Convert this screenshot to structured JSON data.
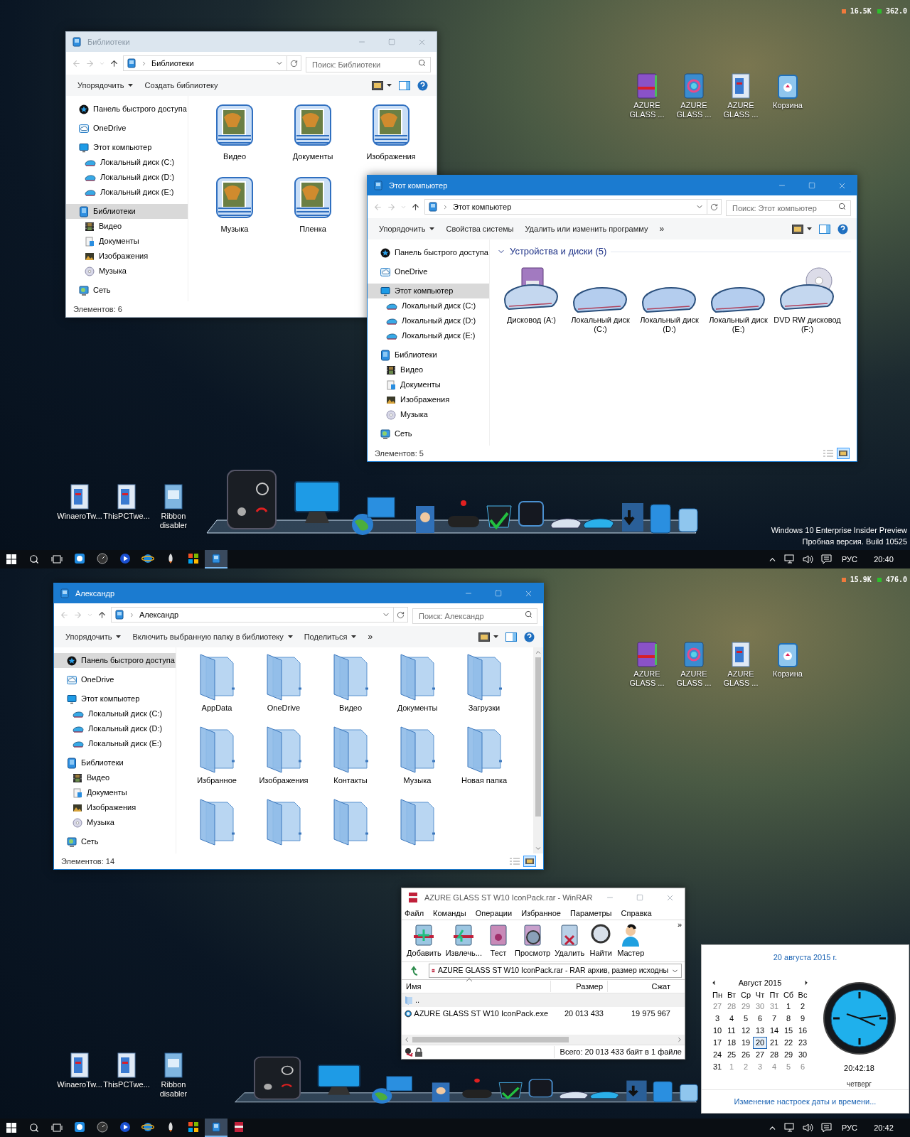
{
  "screens": [
    {
      "meter": [
        {
          "color": "#f07a3c",
          "text": "16.5K"
        },
        {
          "color": "#2cc02c",
          "text": "362.0"
        }
      ],
      "desktop_icons_right": [
        {
          "label": "AZURE GLASS ...",
          "kind": "package"
        },
        {
          "label": "AZURE GLASS ...",
          "kind": "installer"
        },
        {
          "label": "AZURE GLASS ...",
          "kind": "document"
        },
        {
          "label": "Корзина",
          "kind": "recycle"
        }
      ],
      "desktop_icons_left": [
        {
          "label": "WinaeroTw...",
          "kind": "document"
        },
        {
          "label": "ThisPCTwe...",
          "kind": "document"
        },
        {
          "label": "Ribbon disabler",
          "kind": "app"
        }
      ],
      "windows": [
        {
          "title": "Библиотеки",
          "active": false,
          "address": "Библиотеки",
          "search_placeholder": "Поиск: Библиотеки",
          "commands": [
            {
              "label": "Упорядочить",
              "dropdown": true
            },
            {
              "label": "Создать библиотеку",
              "dropdown": false
            }
          ],
          "nav": [
            {
              "label": "Панель быстрого доступа",
              "kind": "quick",
              "selected": false
            },
            {
              "label": "OneDrive",
              "kind": "onedrive",
              "selected": false
            },
            {
              "label": "Этот компьютер",
              "kind": "pc",
              "selected": false,
              "children": [
                {
                  "label": "Локальный диск (C:)",
                  "kind": "drive",
                  "selected": false
                },
                {
                  "label": "Локальный диск (D:)",
                  "kind": "drive",
                  "selected": false
                },
                {
                  "label": "Локальный диск (E:)",
                  "kind": "drive",
                  "selected": false
                }
              ]
            },
            {
              "label": "Библиотеки",
              "kind": "libraries",
              "selected": true,
              "children": [
                {
                  "label": "Видео",
                  "kind": "video",
                  "selected": false
                },
                {
                  "label": "Документы",
                  "kind": "documents",
                  "selected": false
                },
                {
                  "label": "Изображения",
                  "kind": "images",
                  "selected": false
                },
                {
                  "label": "Музыка",
                  "kind": "music",
                  "selected": false
                }
              ]
            },
            {
              "label": "Сеть",
              "kind": "network",
              "selected": false
            }
          ],
          "items": [
            {
              "label": "Видео",
              "kind": "library"
            },
            {
              "label": "Документы",
              "kind": "library"
            },
            {
              "label": "Изображения",
              "kind": "library"
            },
            {
              "label": "Музыка",
              "kind": "library"
            },
            {
              "label": "Пленка",
              "kind": "library"
            }
          ],
          "status": "Элементов: 6"
        },
        {
          "title": "Этот компьютер",
          "active": true,
          "address": "Этот компьютер",
          "search_placeholder": "Поиск: Этот компьютер",
          "commands": [
            {
              "label": "Упорядочить",
              "dropdown": true
            },
            {
              "label": "Свойства системы",
              "dropdown": false
            },
            {
              "label": "Удалить или изменить программу",
              "dropdown": false
            }
          ],
          "more": "»",
          "nav": [
            {
              "label": "Панель быстрого доступа",
              "kind": "quick",
              "selected": false
            },
            {
              "label": "OneDrive",
              "kind": "onedrive",
              "selected": false
            },
            {
              "label": "Этот компьютер",
              "kind": "pc",
              "selected": true,
              "children": [
                {
                  "label": "Локальный диск (C:)",
                  "kind": "drive",
                  "selected": false
                },
                {
                  "label": "Локальный диск (D:)",
                  "kind": "drive",
                  "selected": false
                },
                {
                  "label": "Локальный диск (E:)",
                  "kind": "drive",
                  "selected": false
                }
              ]
            },
            {
              "label": "Библиотеки",
              "kind": "libraries",
              "selected": false,
              "children": [
                {
                  "label": "Видео",
                  "kind": "video",
                  "selected": false
                },
                {
                  "label": "Документы",
                  "kind": "documents",
                  "selected": false
                },
                {
                  "label": "Изображения",
                  "kind": "images",
                  "selected": false
                },
                {
                  "label": "Музыка",
                  "kind": "music",
                  "selected": false
                }
              ]
            },
            {
              "label": "Сеть",
              "kind": "network",
              "selected": false
            }
          ],
          "group": "Устройства и диски (5)",
          "items": [
            {
              "label": "Дисковод (A:)",
              "kind": "floppy"
            },
            {
              "label": "Локальный диск (C:)",
              "kind": "drive"
            },
            {
              "label": "Локальный диск (D:)",
              "kind": "drive"
            },
            {
              "label": "Локальный диск (E:)",
              "kind": "drive"
            },
            {
              "label": "DVD RW дисковод (F:)",
              "kind": "dvd"
            }
          ],
          "status": "Элементов: 5",
          "view_toggle": true
        }
      ],
      "build_info": [
        "Windows 10 Enterprise Insider Preview",
        "Пробная версия. Build 10525"
      ],
      "taskbar": {
        "apps": [
          {
            "kind": "app",
            "selected": false
          },
          {
            "kind": "gauge",
            "selected": false
          },
          {
            "kind": "player",
            "selected": false
          },
          {
            "kind": "browser",
            "selected": false
          },
          {
            "kind": "rocket",
            "selected": false
          },
          {
            "kind": "tiles",
            "selected": false
          },
          {
            "kind": "explorer",
            "selected": true
          }
        ],
        "language": "РУС",
        "time": "20:40"
      }
    },
    {
      "meter": [
        {
          "color": "#f07a3c",
          "text": "15.9K"
        },
        {
          "color": "#2cc02c",
          "text": "476.0"
        }
      ],
      "desktop_icons_right": [
        {
          "label": "AZURE GLASS ...",
          "kind": "package"
        },
        {
          "label": "AZURE GLASS ...",
          "kind": "installer"
        },
        {
          "label": "AZURE GLASS ...",
          "kind": "document"
        },
        {
          "label": "Корзина",
          "kind": "recycle"
        }
      ],
      "desktop_icons_left": [
        {
          "label": "WinaeroTw...",
          "kind": "document"
        },
        {
          "label": "ThisPCTwe...",
          "kind": "document"
        },
        {
          "label": "Ribbon disabler",
          "kind": "app"
        }
      ],
      "windows": [
        {
          "title": "Александр",
          "active": true,
          "address": "Александр",
          "search_placeholder": "Поиск: Александр",
          "commands": [
            {
              "label": "Упорядочить",
              "dropdown": true
            },
            {
              "label": "Включить выбранную папку в библиотеку",
              "dropdown": true
            },
            {
              "label": "Поделиться",
              "dropdown": true
            }
          ],
          "more": "»",
          "nav": [
            {
              "label": "Панель быстрого доступа",
              "kind": "quick",
              "selected": true
            },
            {
              "label": "OneDrive",
              "kind": "onedrive",
              "selected": false
            },
            {
              "label": "Этот компьютер",
              "kind": "pc",
              "selected": false,
              "children": [
                {
                  "label": "Локальный диск (C:)",
                  "kind": "drive",
                  "selected": false
                },
                {
                  "label": "Локальный диск (D:)",
                  "kind": "drive",
                  "selected": false
                },
                {
                  "label": "Локальный диск (E:)",
                  "kind": "drive",
                  "selected": false
                }
              ]
            },
            {
              "label": "Библиотеки",
              "kind": "libraries",
              "selected": false,
              "children": [
                {
                  "label": "Видео",
                  "kind": "video",
                  "selected": false
                },
                {
                  "label": "Документы",
                  "kind": "documents",
                  "selected": false
                },
                {
                  "label": "Изображения",
                  "kind": "images",
                  "selected": false
                },
                {
                  "label": "Музыка",
                  "kind": "music",
                  "selected": false
                }
              ]
            },
            {
              "label": "Сеть",
              "kind": "network",
              "selected": false
            }
          ],
          "items": [
            {
              "label": "AppData",
              "kind": "folder"
            },
            {
              "label": "OneDrive",
              "kind": "folder"
            },
            {
              "label": "Видео",
              "kind": "folder"
            },
            {
              "label": "Документы",
              "kind": "folder"
            },
            {
              "label": "Загрузки",
              "kind": "folder"
            },
            {
              "label": "Избранное",
              "kind": "folder"
            },
            {
              "label": "Изображения",
              "kind": "folder"
            },
            {
              "label": "Контакты",
              "kind": "folder"
            },
            {
              "label": "Музыка",
              "kind": "folder"
            },
            {
              "label": "Новая папка",
              "kind": "folder"
            },
            {
              "kind": "folder"
            },
            {
              "kind": "folder"
            },
            {
              "kind": "folder"
            },
            {
              "kind": "folder"
            }
          ],
          "status": "Элементов: 14",
          "view_toggle": true,
          "scrollbar": true
        }
      ],
      "winrar": {
        "title": "AZURE GLASS ST W10 IconPack.rar - WinRAR",
        "menu": [
          "Файл",
          "Команды",
          "Операции",
          "Избранное",
          "Параметры",
          "Справка"
        ],
        "tools": [
          {
            "label": "Добавить",
            "kind": "add"
          },
          {
            "label": "Извлечь...",
            "kind": "extract"
          },
          {
            "label": "Тест",
            "kind": "test"
          },
          {
            "label": "Просмотр",
            "kind": "view"
          },
          {
            "label": "Удалить",
            "kind": "delete"
          },
          {
            "label": "Найти",
            "kind": "find"
          },
          {
            "label": "Мастер",
            "kind": "wizard"
          }
        ],
        "more": "»",
        "path": "AZURE GLASS ST W10 IconPack.rar - RAR архив, размер исходны",
        "columns": [
          "Имя",
          "Размер",
          "Сжат"
        ],
        "rows": [
          {
            "name": "..",
            "kind": "folder"
          },
          {
            "name": "AZURE GLASS ST W10 IconPack.exe",
            "kind": "file",
            "size": "20 013 433",
            "packed": "19 975 967"
          }
        ],
        "status": "Всего: 20 013 433 байт в 1 файле"
      },
      "calendar": {
        "date": "20 августа 2015 г.",
        "month": "Август 2015",
        "weekdays": [
          "Пн",
          "Вт",
          "Ср",
          "Чт",
          "Пт",
          "Сб",
          "Вс"
        ],
        "days": [
          {
            "day": "27",
            "muted": true,
            "selected": false
          },
          {
            "day": "28",
            "muted": true,
            "selected": false
          },
          {
            "day": "29",
            "muted": true,
            "selected": false
          },
          {
            "day": "30",
            "muted": true,
            "selected": false
          },
          {
            "day": "31",
            "muted": true,
            "selected": false
          },
          {
            "day": "1",
            "muted": false,
            "selected": false
          },
          {
            "day": "2",
            "muted": false,
            "selected": false
          },
          {
            "day": "3",
            "muted": false,
            "selected": false
          },
          {
            "day": "4",
            "muted": false,
            "selected": false
          },
          {
            "day": "5",
            "muted": false,
            "selected": false
          },
          {
            "day": "6",
            "muted": false,
            "selected": false
          },
          {
            "day": "7",
            "muted": false,
            "selected": false
          },
          {
            "day": "8",
            "muted": false,
            "selected": false
          },
          {
            "day": "9",
            "muted": false,
            "selected": false
          },
          {
            "day": "10",
            "muted": false,
            "selected": false
          },
          {
            "day": "11",
            "muted": false,
            "selected": false
          },
          {
            "day": "12",
            "muted": false,
            "selected": false
          },
          {
            "day": "13",
            "muted": false,
            "selected": false
          },
          {
            "day": "14",
            "muted": false,
            "selected": false
          },
          {
            "day": "15",
            "muted": false,
            "selected": false
          },
          {
            "day": "16",
            "muted": false,
            "selected": false
          },
          {
            "day": "17",
            "muted": false,
            "selected": false
          },
          {
            "day": "18",
            "muted": false,
            "selected": false
          },
          {
            "day": "19",
            "muted": false,
            "selected": false
          },
          {
            "day": "20",
            "muted": false,
            "selected": true
          },
          {
            "day": "21",
            "muted": false,
            "selected": false
          },
          {
            "day": "22",
            "muted": false,
            "selected": false
          },
          {
            "day": "23",
            "muted": false,
            "selected": false
          },
          {
            "day": "24",
            "muted": false,
            "selected": false
          },
          {
            "day": "25",
            "muted": false,
            "selected": false
          },
          {
            "day": "26",
            "muted": false,
            "selected": false
          },
          {
            "day": "27",
            "muted": false,
            "selected": false
          },
          {
            "day": "28",
            "muted": false,
            "selected": false
          },
          {
            "day": "29",
            "muted": false,
            "selected": false
          },
          {
            "day": "30",
            "muted": false,
            "selected": false
          },
          {
            "day": "31",
            "muted": false,
            "selected": false
          },
          {
            "day": "1",
            "muted": true,
            "selected": false
          },
          {
            "day": "2",
            "muted": true,
            "selected": false
          },
          {
            "day": "3",
            "muted": true,
            "selected": false
          },
          {
            "day": "4",
            "muted": true,
            "selected": false
          },
          {
            "day": "5",
            "muted": true,
            "selected": false
          },
          {
            "day": "6",
            "muted": true,
            "selected": false
          }
        ],
        "time": "20:42:18",
        "weekday": "четверг",
        "link": "Изменение настроек даты и времени..."
      },
      "taskbar": {
        "apps": [
          {
            "kind": "app",
            "selected": false
          },
          {
            "kind": "gauge",
            "selected": false
          },
          {
            "kind": "player",
            "selected": false
          },
          {
            "kind": "browser",
            "selected": false
          },
          {
            "kind": "rocket",
            "selected": false
          },
          {
            "kind": "tiles",
            "selected": false
          },
          {
            "kind": "explorer",
            "selected": true
          },
          {
            "kind": "archiver",
            "selected": false
          }
        ],
        "language": "РУС",
        "time": "20:42"
      }
    }
  ]
}
